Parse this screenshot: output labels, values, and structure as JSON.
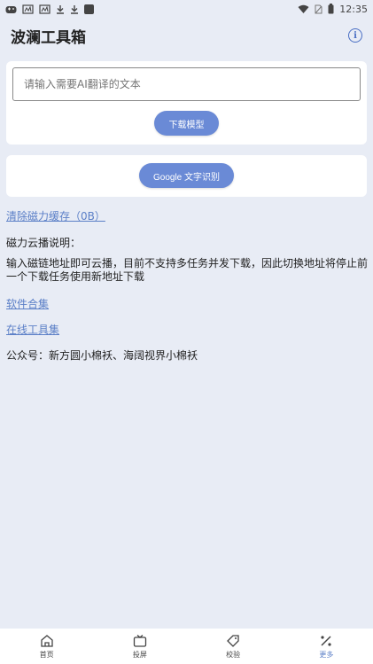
{
  "status": {
    "time": "12:35",
    "left_icons": [
      "gamepad-icon",
      "weather-icon",
      "weather-icon",
      "download-icon",
      "download-icon",
      "app-icon"
    ],
    "right_icons": [
      "wifi-icon",
      "no-sim-icon",
      "battery-icon"
    ]
  },
  "app": {
    "title": "波澜工具箱",
    "info_icon": "info-icon"
  },
  "translate": {
    "placeholder": "请输入需要AI翻译的文本",
    "download_model": "下载模型"
  },
  "ocr": {
    "button": "Google 文字识别"
  },
  "links": {
    "clear_cache": "清除磁力缓存（0B）",
    "software": "软件合集",
    "online_tools": "在线工具集"
  },
  "magnet": {
    "heading": "磁力云播说明：",
    "description": "输入磁链地址即可云播，目前不支持多任务并发下载，因此切换地址将停止前一个下载任务使用新地址下载"
  },
  "wechat": {
    "text": "公众号：新方圆小棉袄、海阔视界小棉袄"
  },
  "nav": [
    {
      "label": "首页",
      "icon": "home-icon"
    },
    {
      "label": "投屏",
      "icon": "tv-icon"
    },
    {
      "label": "校验",
      "icon": "tag-icon"
    },
    {
      "label": "更多",
      "icon": "more-icon"
    }
  ],
  "colors": {
    "accent": "#6a8ad6",
    "link": "#5b7fc7",
    "background": "#e8ecf5"
  }
}
